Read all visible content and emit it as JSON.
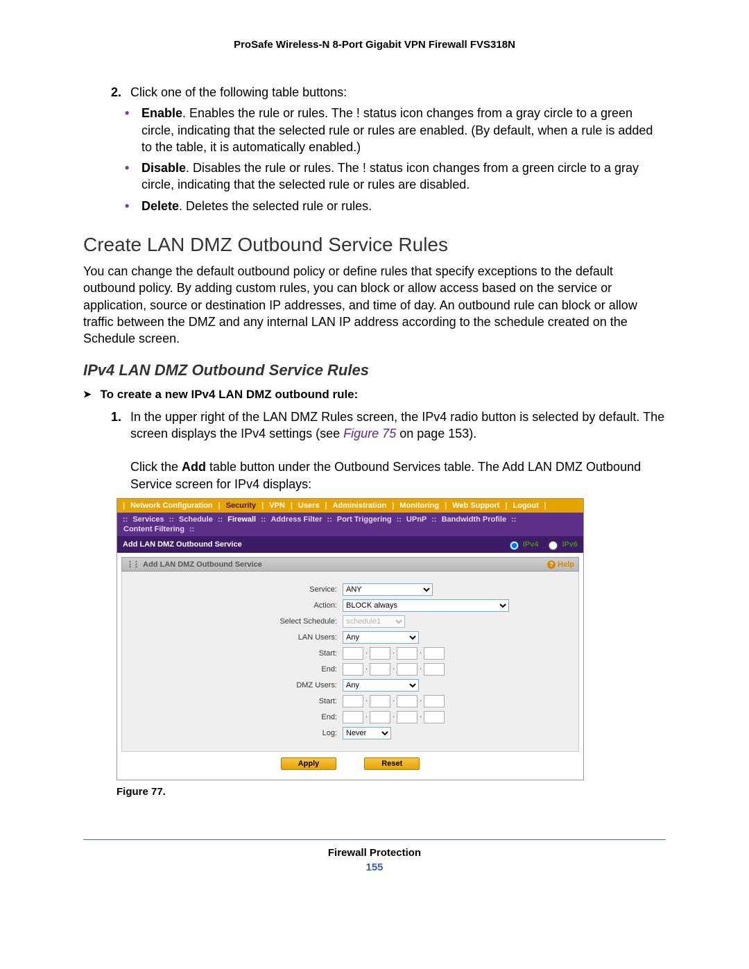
{
  "header": "ProSafe Wireless-N 8-Port Gigabit VPN Firewall FVS318N",
  "step2_intro": "Click one of the following table buttons:",
  "bullets": [
    {
      "bold": "Enable",
      "rest": ". Enables the rule or rules. The ! status icon changes from a gray circle to a green circle, indicating that the selected rule or rules are enabled. (By default, when a rule is added to the table, it is automatically enabled.)"
    },
    {
      "bold": "Disable",
      "rest": ". Disables the rule or rules. The ! status icon changes from a green circle to a gray circle, indicating that the selected rule or rules are disabled."
    },
    {
      "bold": "Delete",
      "rest": ". Deletes the selected rule or rules."
    }
  ],
  "h2": "Create LAN DMZ Outbound Service Rules",
  "h2_body": "You can change the default outbound policy or define rules that specify exceptions to the default outbound policy. By adding custom rules, you can block or allow access based on the service or application, source or destination IP addresses, and time of day. An outbound rule can block or allow traffic between the DMZ and any internal LAN IP address according to the schedule created on the Schedule screen.",
  "h3": "IPv4 LAN DMZ Outbound Service Rules",
  "proc": "To create a new IPv4 LAN DMZ outbound rule:",
  "step1a": "In the upper right of the LAN DMZ Rules screen, the IPv4 radio button is selected by default. The screen displays the IPv4 settings (see ",
  "figref": "Figure 75",
  "step1b": " on page 153).",
  "step1c_pre": "Click the ",
  "step1c_bold": "Add",
  "step1c_post": " table button under the Outbound Services table. The Add LAN DMZ Outbound Service screen for IPv4 displays:",
  "shot": {
    "tabs1": [
      "Network Configuration",
      "Security",
      "VPN",
      "Users",
      "Administration",
      "Monitoring",
      "Web Support",
      "Logout"
    ],
    "tabs1_active": "Security",
    "tabs2": [
      "Services",
      "Schedule",
      "Firewall",
      "Address Filter",
      "Port Triggering",
      "UPnP",
      "Bandwidth Profile",
      "Content Filtering"
    ],
    "tabs2_active": "Firewall",
    "crumb": "Add LAN DMZ Outbound Service",
    "ip": {
      "v4": "IPv4",
      "v6": "IPv6",
      "selected": "IPv4"
    },
    "panel_title": "Add LAN DMZ Outbound Service",
    "help": "Help",
    "fields": {
      "service": {
        "label": "Service:",
        "value": "ANY"
      },
      "action": {
        "label": "Action:",
        "value": "BLOCK always"
      },
      "schedule": {
        "label": "Select Schedule:",
        "value": "schedule1"
      },
      "lan_users": {
        "label": "LAN Users:",
        "value": "Any"
      },
      "lan_start": {
        "label": "Start:"
      },
      "lan_end": {
        "label": "End:"
      },
      "dmz_users": {
        "label": "DMZ Users:",
        "value": "Any"
      },
      "dmz_start": {
        "label": "Start:"
      },
      "dmz_end": {
        "label": "End:"
      },
      "log": {
        "label": "Log:",
        "value": "Never"
      }
    },
    "buttons": {
      "apply": "Apply",
      "reset": "Reset"
    }
  },
  "figcaption": "Figure 77.",
  "footer": {
    "title": "Firewall Protection",
    "page": "155"
  }
}
